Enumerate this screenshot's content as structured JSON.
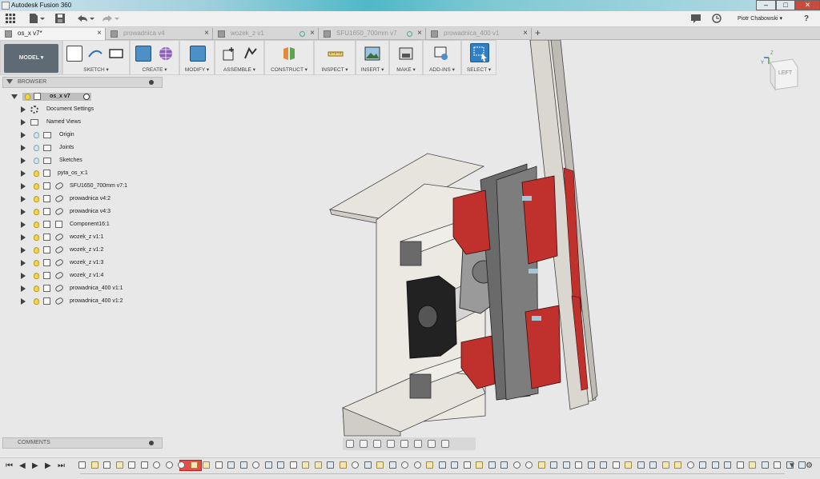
{
  "window": {
    "title": "Autodesk Fusion 360",
    "controls": {
      "minimize": "–",
      "maximize": "□",
      "close": "✕"
    }
  },
  "menubar": {
    "user": "Piotr Chabowski ▾",
    "help": "?"
  },
  "tabs": [
    {
      "label": "os_x v7*",
      "active": true
    },
    {
      "label": "prowadnica v4",
      "active": false
    },
    {
      "label": "wozek_z v1",
      "active": false
    },
    {
      "label": "SFU1650_700mm v7",
      "active": false
    },
    {
      "label": "prowadnica_400 v1",
      "active": false
    }
  ],
  "toolbar": {
    "workspace": "MODEL ▾",
    "groups": [
      "SKETCH ▾",
      "CREATE ▾",
      "MODIFY ▾",
      "ASSEMBLE ▾",
      "CONSTRUCT ▾",
      "INSPECT ▾",
      "INSERT ▾",
      "MAKE ▾",
      "ADD-INS ▾",
      "SELECT ▾"
    ]
  },
  "browser": {
    "title": "BROWSER",
    "root": "os_x v7",
    "items": [
      "Document Settings",
      "Named Views",
      "Origin",
      "Joints",
      "Sketches",
      "pyta_os_x:1",
      "SFU1650_700mm v7:1",
      "prowadnica v4:2",
      "prowadnica v4:3",
      "Component16:1",
      "wozek_z v1:1",
      "wozek_z v1:2",
      "wozek_z v1:3",
      "wozek_z v1:4",
      "prowadnica_400 v1:1",
      "prowadnica_400 v1:2"
    ]
  },
  "comments": {
    "title": "COMMENTS"
  },
  "viewcube": {
    "face": "LEFT",
    "axis_z": "Z",
    "axis_y": "Y"
  },
  "colors": {
    "accent": "#1e7fc1",
    "part_red": "#c0302c",
    "part_grey": "#6a6a6a",
    "part_light": "#e8e6e0"
  }
}
